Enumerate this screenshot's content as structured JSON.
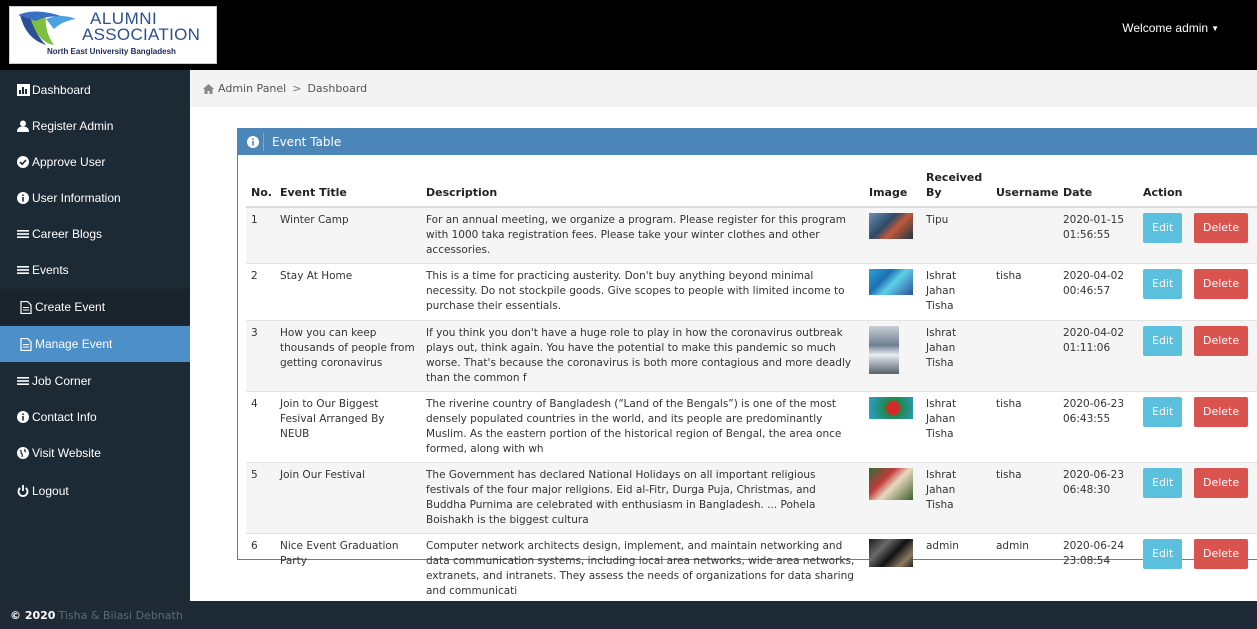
{
  "header": {
    "logo_line1": "ALUMNI",
    "logo_line2": "ASSOCIATION",
    "logo_line3": "North East University Bangladesh",
    "welcome": "Welcome admin"
  },
  "sidebar": {
    "items": [
      {
        "label": "Dashboard",
        "icon": "bar-chart-icon"
      },
      {
        "label": "Register Admin",
        "icon": "user-icon"
      },
      {
        "label": "Approve User",
        "icon": "check-circle-icon"
      },
      {
        "label": "User Information",
        "icon": "info-circle-icon"
      },
      {
        "label": "Career Blogs",
        "icon": "bars-icon"
      },
      {
        "label": "Events",
        "icon": "bars-icon"
      },
      {
        "label": "Create Event",
        "icon": "file-icon"
      },
      {
        "label": "Manage Event",
        "icon": "file-icon"
      },
      {
        "label": "Job Corner",
        "icon": "bars-icon"
      },
      {
        "label": "Contact Info",
        "icon": "info-circle-icon"
      },
      {
        "label": "Visit Website",
        "icon": "globe-icon"
      },
      {
        "label": "Logout",
        "icon": "power-icon"
      }
    ]
  },
  "breadcrumb": {
    "home": "Admin Panel",
    "separator": ">",
    "current": "Dashboard"
  },
  "panel": {
    "title": "Event Table"
  },
  "table": {
    "headers": {
      "no": "No.",
      "title": "Event Title",
      "description": "Description",
      "image": "Image",
      "received": "Received By",
      "username": "Username",
      "date": "Date",
      "action": "Action"
    },
    "edit_label": "Edit",
    "delete_label": "Delete",
    "rows": [
      {
        "no": "1",
        "title": "Winter Camp",
        "description": "For an annual meeting, we organize a program. Please register for this program with 1000 taka registration fees. Please take your winter clothes and other accessories.",
        "received": "Tipu",
        "username": "",
        "date": "2020-01-15 01:56:55"
      },
      {
        "no": "2",
        "title": "Stay At Home",
        "description": "This is a time for practicing austerity. Don't buy anything beyond minimal necessity. Do not stockpile goods. Give scopes to people with limited income to purchase their essentials.",
        "received": "Ishrat Jahan Tisha",
        "username": "tisha",
        "date": "2020-04-02 00:46:57"
      },
      {
        "no": "3",
        "title": "How you can keep thousands of people from getting coronavirus",
        "description": "If you think you don't have a huge role to play in how the coronavirus outbreak plays out, think again. You have the potential to make this pandemic so much worse. That's because the coronavirus is both more contagious and more deadly than the common f",
        "received": "Ishrat Jahan Tisha",
        "username": "",
        "date": "2020-04-02 01:11:06"
      },
      {
        "no": "4",
        "title": "Join to Our Biggest Fesival Arranged By NEUB",
        "description": "The riverine country of Bangladesh (“Land of the Bengals”) is one of the most densely populated countries in the world, and its people are predominantly Muslim. As the eastern portion of the historical region of Bengal, the area once formed, along with wh",
        "received": "Ishrat Jahan Tisha",
        "username": "tisha",
        "date": "2020-06-23 06:43:55"
      },
      {
        "no": "5",
        "title": "Join Our Festival",
        "description": "The Government has declared National Holidays on all important religious festivals of the four major religions. Eid al-Fitr, Durga Puja, Christmas, and Buddha Purnima are celebrated with enthusiasm in Bangladesh. ... Pohela Boishakh is the biggest cultura",
        "received": "Ishrat Jahan Tisha",
        "username": "tisha",
        "date": "2020-06-23 06:48:30"
      },
      {
        "no": "6",
        "title": "Nice Event Graduation Party",
        "description": "Computer network architects design, implement, and maintain networking and data communication systems, including local area networks, wide area networks, extranets, and intranets. They assess the needs of organizations for data sharing and communicati",
        "received": "admin",
        "username": "admin",
        "date": "2020-06-24 23:08:54"
      }
    ]
  },
  "footer": {
    "copyright": "© 2020",
    "authors": "Tisha & Bilasi Debnath"
  },
  "colors": {
    "accent": "#4d8fc8",
    "panel": "#4c86b9",
    "edit": "#5bc0de",
    "delete": "#d9534f",
    "sidebar": "#1c2a35"
  }
}
